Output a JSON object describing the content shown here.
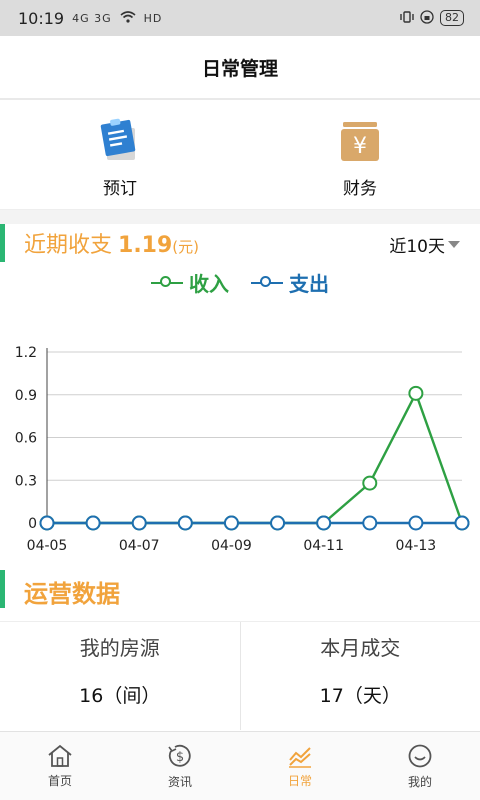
{
  "status_bar": {
    "time": "10:19",
    "network": "4G 3G",
    "hd": "HD",
    "battery": "82"
  },
  "app_bar": {
    "title": "日常管理"
  },
  "tiles": [
    {
      "label": "预订",
      "icon": "clipboard-icon"
    },
    {
      "label": "财务",
      "icon": "yen-icon",
      "glyph": "¥"
    }
  ],
  "recent": {
    "title": "近期收支",
    "amount": "1.19",
    "unit": "(元)",
    "range": "近10天"
  },
  "legend": {
    "income": "收入",
    "expense": "支出"
  },
  "colors": {
    "accent": "#f1a33c",
    "income": "#2ea043",
    "expense": "#1e6fb0",
    "bar": "#2bb673"
  },
  "chart_data": {
    "type": "line",
    "x": [
      "04-05",
      "04-06",
      "04-07",
      "04-08",
      "04-09",
      "04-10",
      "04-11",
      "04-12",
      "04-13",
      "04-14"
    ],
    "x_tick_labels": [
      "04-05",
      "04-07",
      "04-09",
      "04-11",
      "04-13"
    ],
    "y_tick_labels": [
      "0",
      "0.3",
      "0.6",
      "0.9",
      "1.2"
    ],
    "ylim": [
      0,
      1.2
    ],
    "grid": true,
    "legend_position": "top",
    "series": [
      {
        "name": "收入",
        "values": [
          0,
          0,
          0,
          0,
          0,
          0,
          0,
          0.28,
          0.91,
          0
        ]
      },
      {
        "name": "支出",
        "values": [
          0,
          0,
          0,
          0,
          0,
          0,
          0,
          0,
          0,
          0
        ]
      }
    ]
  },
  "ops": {
    "title": "运营数据",
    "cards": [
      {
        "label": "我的房源",
        "value": "16（间）"
      },
      {
        "label": "本月成交",
        "value": "17（天）"
      }
    ]
  },
  "nav": [
    {
      "label": "首页",
      "icon": "home-icon"
    },
    {
      "label": "资讯",
      "icon": "dollar-circle-icon"
    },
    {
      "label": "日常",
      "icon": "chart-icon"
    },
    {
      "label": "我的",
      "icon": "smile-icon"
    }
  ]
}
